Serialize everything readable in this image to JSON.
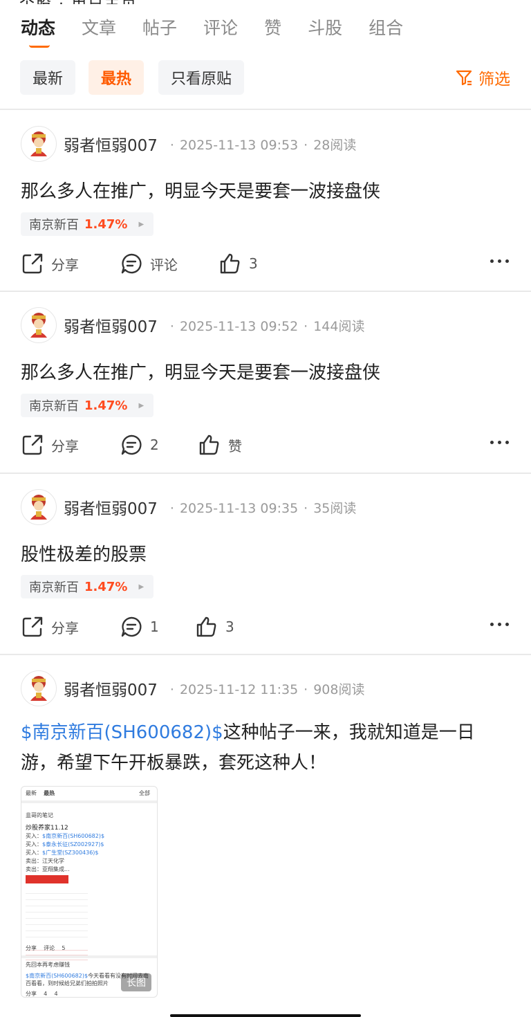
{
  "tabs": [
    "动态",
    "文章",
    "帖子",
    "评论",
    "赞",
    "斗股",
    "组合"
  ],
  "filters": {
    "chips": [
      "最新",
      "最热",
      "只看原贴"
    ],
    "filter_label": "筛选"
  },
  "posts": [
    {
      "user": "弱者恒弱007",
      "time": "2025-11-13 09:53",
      "reads": "28阅读",
      "text": "那么多人在推广，明显今天是要套一波接盘侠",
      "stock": {
        "name": "南京新百",
        "pct": "1.47%"
      },
      "share": "分享",
      "comment": "评论",
      "like": "3"
    },
    {
      "user": "弱者恒弱007",
      "time": "2025-11-13 09:52",
      "reads": "144阅读",
      "text": "那么多人在推广，明显今天是要套一波接盘侠",
      "stock": {
        "name": "南京新百",
        "pct": "1.47%"
      },
      "share": "分享",
      "comment": "2",
      "like": "赞"
    },
    {
      "user": "弱者恒弱007",
      "time": "2025-11-13 09:35",
      "reads": "35阅读",
      "text": "股性极差的股票",
      "stock": {
        "name": "南京新百",
        "pct": "1.47%"
      },
      "share": "分享",
      "comment": "1",
      "like": "3"
    },
    {
      "user": "弱者恒弱007",
      "time": "2025-11-12 11:35",
      "reads": "908阅读",
      "link": "$南京新百(SH600682)$",
      "text": "这种帖子一来，我就知道是一日游，希望下午开板暴跌，套死这种人！"
    }
  ],
  "thumb": {
    "tab1": "最新",
    "tab2": "最热",
    "filter": "全部",
    "author": "韭哥的笔记",
    "title": "炒股养家11.12",
    "lines": [
      "买入：",
      "买入：",
      "买入：",
      "卖出：江天化学",
      "卖出：亚翔集成..."
    ],
    "links": [
      "$南京新百(SH600682)$",
      "$泰永长征(SZ002927)$",
      "$广生堂(SZ300436)$"
    ],
    "share": "分享",
    "comment": "评论",
    "like": "5",
    "author2": "先回本再考虑赚钱",
    "quote_link": "$南京新百(SH600682)$",
    "quote": "今天看看有没有时间去南百看看，到时候给兄弟们拍拍照片",
    "share2": "分享",
    "comment2": "4",
    "like2": "4",
    "badge": "长图"
  }
}
